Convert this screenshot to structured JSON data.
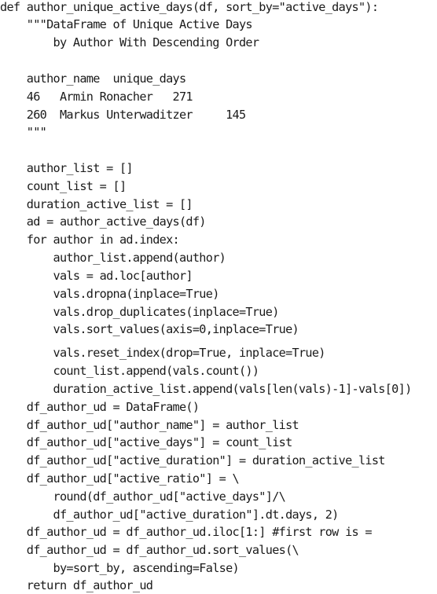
{
  "code": {
    "lines": [
      "def author_unique_active_days(df, sort_by=\"active_days\"):",
      "    \"\"\"DataFrame of Unique Active Days",
      "        by Author With Descending Order",
      "",
      "    author_name  unique_days",
      "    46   Armin Ronacher   271",
      "    260  Markus Unterwaditzer     145",
      "    \"\"\"",
      "",
      "    author_list = []",
      "    count_list = []",
      "    duration_active_list = []",
      "    ad = author_active_days(df)",
      "    for author in ad.index:",
      "        author_list.append(author)",
      "        vals = ad.loc[author]",
      "        vals.dropna(inplace=True)",
      "        vals.drop_duplicates(inplace=True)",
      "        vals.sort_values(axis=0,inplace=True)",
      "        vals.reset_index(drop=True, inplace=True)",
      "        count_list.append(vals.count())",
      "        duration_active_list.append(vals[len(vals)-1]-vals[0])",
      "    df_author_ud = DataFrame()",
      "    df_author_ud[\"author_name\"] = author_list",
      "    df_author_ud[\"active_days\"] = count_list",
      "    df_author_ud[\"active_duration\"] = duration_active_list",
      "    df_author_ud[\"active_ratio\"] = \\",
      "        round(df_author_ud[\"active_days\"]/\\",
      "        df_author_ud[\"active_duration\"].dt.days, 2)",
      "    df_author_ud = df_author_ud.iloc[1:] #first row is =",
      "    df_author_ud = df_author_ud.sort_values(\\",
      "        by=sort_by, ascending=False)",
      "    return df_author_ud"
    ]
  }
}
